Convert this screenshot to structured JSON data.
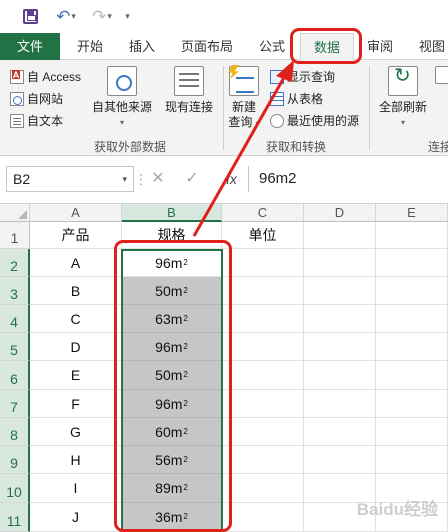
{
  "quick_access": {
    "undo": "↶",
    "redo": "↷",
    "caret": "▾",
    "more": "▾"
  },
  "tabs": [
    "文件",
    "开始",
    "插入",
    "页面布局",
    "公式",
    "数据",
    "审阅",
    "视图"
  ],
  "ribbon": {
    "get_external": {
      "access": "自 Access",
      "web": "自网站",
      "text": "自文本",
      "other": "自其他来源",
      "existing": "现有连接",
      "label": "获取外部数据"
    },
    "get_transform": {
      "new_query_line1": "新建",
      "new_query_line2": "查询",
      "show_queries": "显示查询",
      "from_table": "从表格",
      "recent_sources": "最近使用的源",
      "label": "获取和转换"
    },
    "connections": {
      "refresh_all": "全部刷新",
      "label": "连接"
    }
  },
  "formula_bar": {
    "name_box": "B2",
    "cancel": "✕",
    "enter": "✓",
    "fx": "fx",
    "value": "96m2"
  },
  "sheet": {
    "columns": [
      "A",
      "B",
      "C",
      "D",
      "E"
    ],
    "rows": [
      "1",
      "2",
      "3",
      "4",
      "5",
      "6",
      "7",
      "8",
      "9",
      "10",
      "11"
    ],
    "header_row": {
      "a": "产品",
      "b": "规格",
      "c": "单位"
    },
    "products": [
      "A",
      "B",
      "C",
      "D",
      "E",
      "F",
      "G",
      "H",
      "I",
      "J"
    ],
    "specs": [
      {
        "num": "96m",
        "exp": "2"
      },
      {
        "num": "50m",
        "exp": "2"
      },
      {
        "num": "63m",
        "exp": "2"
      },
      {
        "num": "96m",
        "exp": "2"
      },
      {
        "num": "50m",
        "exp": "2"
      },
      {
        "num": "96m",
        "exp": "2"
      },
      {
        "num": "60m",
        "exp": "2"
      },
      {
        "num": "56m",
        "exp": "2"
      },
      {
        "num": "89m",
        "exp": "2"
      },
      {
        "num": "36m",
        "exp": "2"
      }
    ]
  },
  "watermark": "Baidu经验",
  "colors": {
    "excel_green": "#217346",
    "highlight_red": "#e0201b",
    "selection_grey": "#c6c6c6"
  }
}
